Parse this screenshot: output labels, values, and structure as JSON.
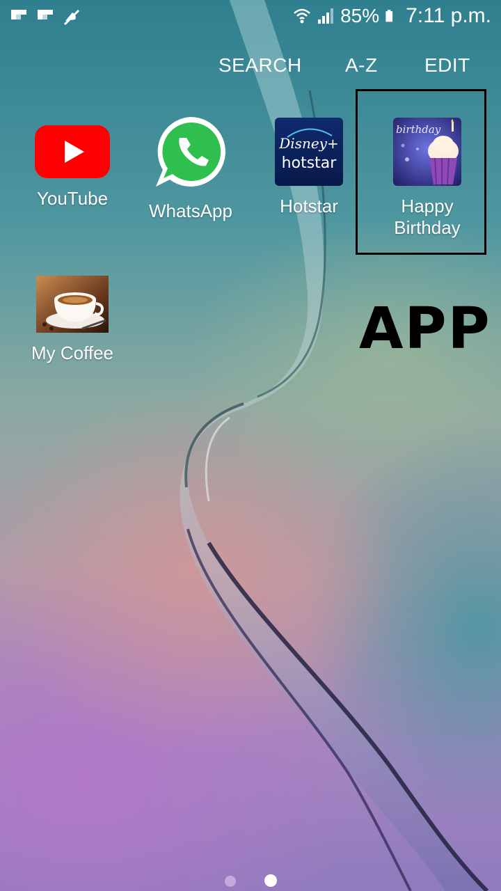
{
  "status_bar": {
    "battery_percent": "85%",
    "time": "7:11 p.m.",
    "icons": [
      "flipboard-icon",
      "flipboard-icon",
      "no-sound-icon",
      "wifi-icon",
      "signal-icon",
      "battery-icon"
    ]
  },
  "actions": {
    "search": "SEARCH",
    "az": "A-Z",
    "edit": "EDIT"
  },
  "apps": [
    {
      "label": "YouTube",
      "icon": "youtube-icon"
    },
    {
      "label": "WhatsApp",
      "icon": "whatsapp-icon"
    },
    {
      "label": "Hotstar",
      "icon": "hotstar-icon"
    },
    {
      "label": "Happy Birthday",
      "icon": "birthday-cupcake-icon"
    },
    {
      "label": "My Coffee",
      "icon": "coffee-cup-icon"
    }
  ],
  "hotstar_logo": {
    "line1": "Disney+",
    "line2": "hotstar"
  },
  "birthday_icon_text": "birthday",
  "annotation": "APP",
  "pager": {
    "current_page": 2,
    "total_pages": 2
  },
  "colors": {
    "youtube_red": "#ff0000",
    "whatsapp_green": "#25d366",
    "hotstar_blue": "#0c1f5c",
    "highlight_border": "#000000"
  }
}
